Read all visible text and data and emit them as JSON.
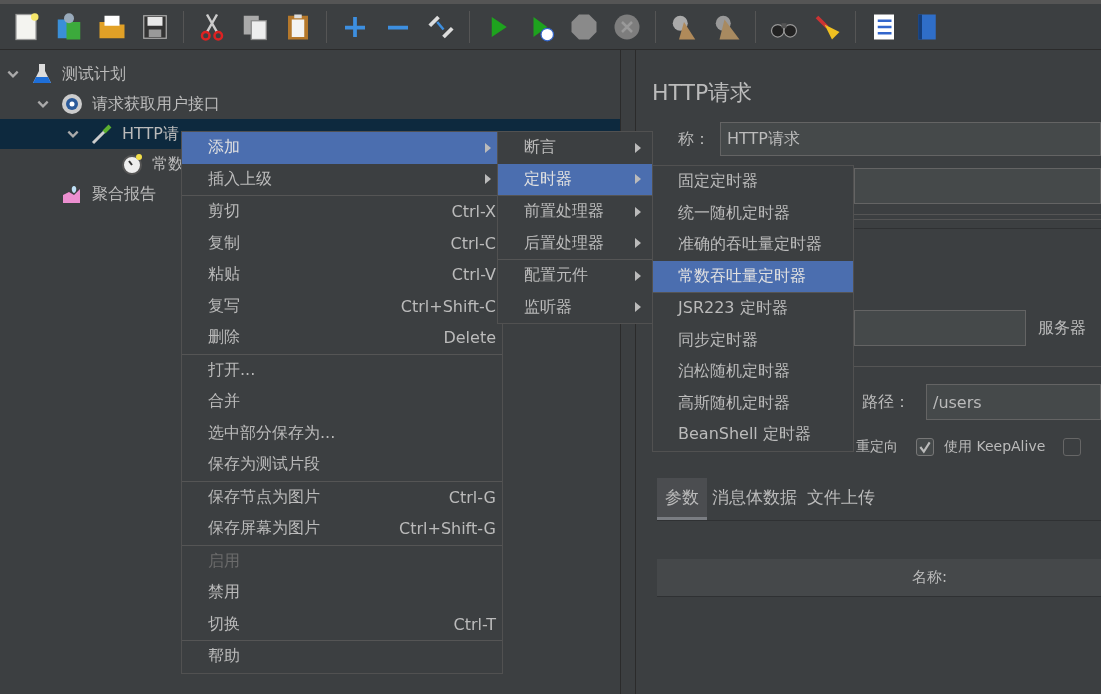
{
  "tree": [
    {
      "label": "测试计划",
      "kind": "plan",
      "expanded": true,
      "selected": false,
      "children": [
        {
          "label": "请求获取用户接口",
          "kind": "group",
          "expanded": true,
          "selected": false,
          "children": [
            {
              "label": "HTTP请",
              "kind": "sampler",
              "expanded": true,
              "selected": true,
              "children": [
                {
                  "label": "常数",
                  "kind": "timer",
                  "selected": false
                }
              ]
            }
          ]
        },
        {
          "label": "聚合报告",
          "kind": "report",
          "selected": false
        }
      ]
    }
  ],
  "panel": {
    "title": "HTTP请求",
    "name_label": "称：",
    "name_value": "HTTP请求",
    "server_label": "服务器",
    "path_label": "路径：",
    "path_value": "/users",
    "redirect_label": "重定向",
    "checkboxes": [
      {
        "label": "使用 KeepAlive",
        "checked": true
      },
      {
        "checked": false
      }
    ],
    "tabs": [
      {
        "label": "参数",
        "selected": true
      },
      {
        "label": "消息体数据",
        "selected": false
      },
      {
        "label": "文件上传",
        "selected": false
      }
    ],
    "table_header": "名称:"
  },
  "context_menu": {
    "groups": [
      [
        {
          "label": "添加",
          "submenu": true,
          "selected": true,
          "disabled": false
        },
        {
          "label": "插入上级",
          "submenu": true,
          "selected": false,
          "disabled": false
        }
      ],
      [
        {
          "label": "剪切",
          "shortcut": "Ctrl-X",
          "selected": false,
          "disabled": false
        },
        {
          "label": "复制",
          "shortcut": "Ctrl-C",
          "selected": false,
          "disabled": false
        },
        {
          "label": "粘贴",
          "shortcut": "Ctrl-V",
          "selected": false,
          "disabled": false
        },
        {
          "label": "复写",
          "shortcut": "Ctrl+Shift-C",
          "selected": false,
          "disabled": false
        },
        {
          "label": "删除",
          "shortcut": "Delete",
          "selected": false,
          "disabled": false
        }
      ],
      [
        {
          "label": "打开...",
          "selected": false,
          "disabled": false
        },
        {
          "label": "合并",
          "selected": false,
          "disabled": false
        },
        {
          "label": "选中部分保存为...",
          "selected": false,
          "disabled": false
        },
        {
          "label": "保存为测试片段",
          "selected": false,
          "disabled": false
        }
      ],
      [
        {
          "label": "保存节点为图片",
          "shortcut": "Ctrl-G",
          "selected": false,
          "disabled": false
        },
        {
          "label": "保存屏幕为图片",
          "shortcut": "Ctrl+Shift-G",
          "selected": false,
          "disabled": false
        }
      ],
      [
        {
          "label": "启用",
          "selected": false,
          "disabled": true
        },
        {
          "label": "禁用",
          "selected": false,
          "disabled": false
        },
        {
          "label": "切换",
          "shortcut": "Ctrl-T",
          "selected": false,
          "disabled": false
        }
      ],
      [
        {
          "label": "帮助",
          "selected": false,
          "disabled": false
        }
      ]
    ]
  },
  "add_menu": {
    "groups": [
      [
        {
          "label": "断言",
          "submenu": true,
          "selected": false
        },
        {
          "label": "定时器",
          "submenu": true,
          "selected": true
        }
      ],
      [
        {
          "label": "前置处理器",
          "submenu": true,
          "selected": false
        },
        {
          "label": "后置处理器",
          "submenu": true,
          "selected": false
        }
      ],
      [
        {
          "label": "配置元件",
          "submenu": true,
          "selected": false
        },
        {
          "label": "监听器",
          "submenu": true,
          "selected": false
        }
      ]
    ]
  },
  "timer_menu": {
    "groups": [
      [
        {
          "label": "固定定时器",
          "selected": false
        },
        {
          "label": "统一随机定时器",
          "selected": false
        },
        {
          "label": "准确的吞吐量定时器",
          "selected": false
        },
        {
          "label": "常数吞吐量定时器",
          "selected": true
        }
      ],
      [
        {
          "label": "JSR223 定时器",
          "selected": false
        },
        {
          "label": "同步定时器",
          "selected": false
        },
        {
          "label": "泊松随机定时器",
          "selected": false
        },
        {
          "label": "高斯随机定时器",
          "selected": false
        },
        {
          "label": "BeanShell 定时器",
          "selected": false
        }
      ]
    ]
  }
}
